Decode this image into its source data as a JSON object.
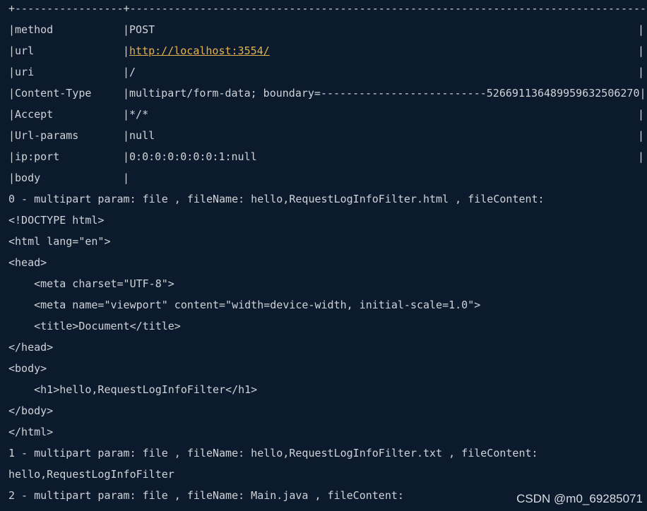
{
  "table": {
    "border_top": "+-----------------+------------------------------------------------------------------------------------+",
    "rows": [
      {
        "key": "|method",
        "sep": "|",
        "value": "POST",
        "end": "|"
      },
      {
        "key": "|url",
        "sep": "|",
        "value": "http://localhost:3554/",
        "end": "|"
      },
      {
        "key": "|uri",
        "sep": "|",
        "value": "/",
        "end": "|"
      },
      {
        "key": "|Content-Type",
        "sep": "|",
        "value": "multipart/form-data; boundary=--------------------------526691136489959632506270|",
        "end": ""
      },
      {
        "key": "|Accept",
        "sep": "|",
        "value": "*/*",
        "end": "|"
      },
      {
        "key": "|Url-params",
        "sep": "|",
        "value": "null",
        "end": "|"
      },
      {
        "key": "|ip:port",
        "sep": "|",
        "value": "0:0:0:0:0:0:0:1:null",
        "end": "|"
      },
      {
        "key": "|body",
        "sep": "|",
        "value": "",
        "end": ""
      }
    ]
  },
  "body_lines": [
    "0 - multipart param: file , fileName: hello,RequestLogInfoFilter.html , fileContent:",
    "<!DOCTYPE html>",
    "<html lang=\"en\">",
    "<head>",
    "    <meta charset=\"UTF-8\">",
    "    <meta name=\"viewport\" content=\"width=device-width, initial-scale=1.0\">",
    "    <title>Document</title>",
    "</head>",
    "<body>",
    "    <h1>hello,RequestLogInfoFilter</h1>",
    "</body>",
    "</html>",
    "1 - multipart param: file , fileName: hello,RequestLogInfoFilter.txt , fileContent:",
    "hello,RequestLogInfoFilter",
    "2 - multipart param: file , fileName: Main.java , fileContent:"
  ],
  "watermark": "CSDN @m0_69285071",
  "colors": {
    "background": "#0b1a2c",
    "text": "#cfd3d8",
    "link": "#e3b34d"
  }
}
